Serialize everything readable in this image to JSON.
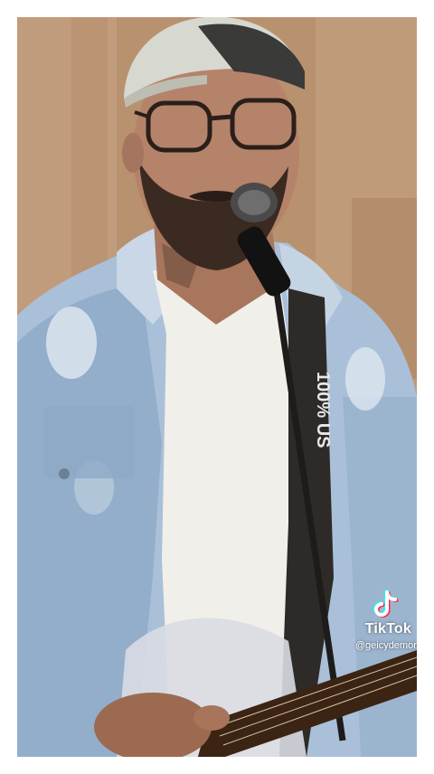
{
  "video": {
    "strap_text": "100% US",
    "watermark": {
      "brand": "TikTok",
      "handle": "@geicydemora"
    }
  },
  "colors": {
    "background": "#ffffff",
    "denim": "#9fb8d3",
    "shirt": "#f1efe9",
    "beard": "#3b2a22"
  },
  "icons": [
    "tiktok-logo-icon"
  ]
}
